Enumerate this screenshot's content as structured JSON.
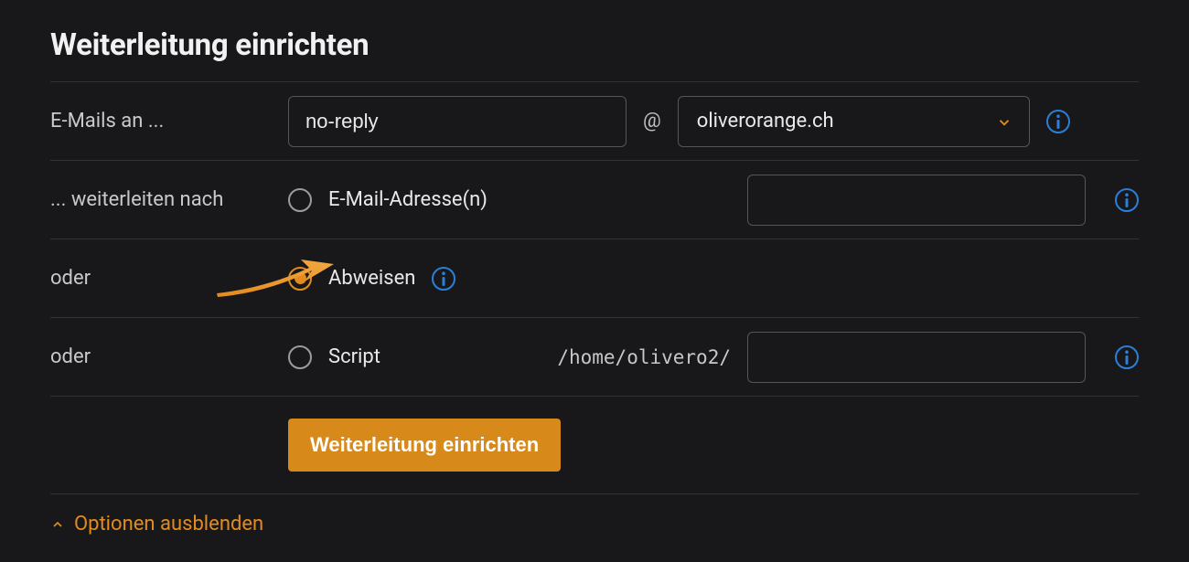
{
  "title": "Weiterleitung einrichten",
  "rows": {
    "emails_to": {
      "label": "E-Mails an ...",
      "local_value": "no-reply",
      "at": "@",
      "domain_value": "oliverorange.ch"
    },
    "forward": {
      "label": "... weiterleiten nach",
      "radio_label": "E-Mail-Adresse(n)",
      "dest_value": ""
    },
    "reject": {
      "label": "oder",
      "radio_label": "Abweisen"
    },
    "script": {
      "label": "oder",
      "radio_label": "Script",
      "path_prefix": "/home/olivero2/",
      "script_value": ""
    }
  },
  "submit_label": "Weiterleitung einrichten",
  "options_toggle": "Optionen ausblenden"
}
